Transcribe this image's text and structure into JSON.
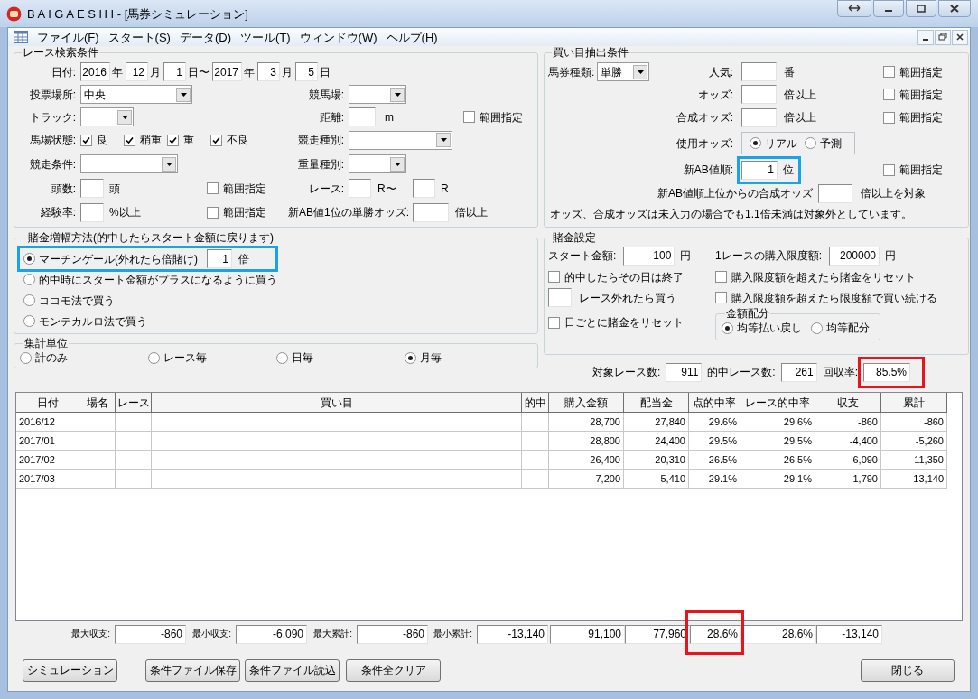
{
  "window": {
    "title": "B A I G A E S H I - [馬券シミュレーション]"
  },
  "menu": [
    "ファイル(F)",
    "スタート(S)",
    "データ(D)",
    "ツール(T)",
    "ウィンドウ(W)",
    "ヘルプ(H)"
  ],
  "race_search": {
    "title": "レース検索条件",
    "date": {
      "label": "日付:",
      "parts": [
        {
          "value": "2016",
          "unit": "年"
        },
        {
          "value": "12",
          "unit": "月"
        },
        {
          "value": "1",
          "unit": "日〜"
        },
        {
          "value": "2017",
          "unit": "年"
        },
        {
          "value": "3",
          "unit": "月"
        },
        {
          "value": "5",
          "unit": "日"
        }
      ]
    },
    "venue_type": {
      "label": "投票場所:",
      "value": "中央"
    },
    "racecourse": {
      "label": "競馬場:"
    },
    "track": {
      "label": "トラック:"
    },
    "distance": {
      "label": "距離:",
      "unit": "m"
    },
    "distance_range": {
      "label": "範囲指定",
      "checked": false
    },
    "going": {
      "label": "馬場状態:",
      "options": [
        {
          "label": "良",
          "checked": true
        },
        {
          "label": "稍重",
          "checked": true
        },
        {
          "label": "重",
          "checked": true
        },
        {
          "label": "不良",
          "checked": true
        }
      ]
    },
    "race_type": {
      "label": "競走種別:"
    },
    "race_condition": {
      "label": "競走条件:"
    },
    "weight_type": {
      "label": "重量種別:"
    },
    "runners": {
      "label": "頭数:",
      "unit": "頭"
    },
    "runners_range": {
      "label": "範囲指定",
      "checked": false
    },
    "race": {
      "label": "レース:",
      "from_unit": "R〜",
      "to_unit": "R"
    },
    "experience": {
      "label": "経験率:",
      "unit": "%以上"
    },
    "experience_range": {
      "label": "範囲指定",
      "checked": false
    },
    "ab_top_odds": {
      "label": "新AB値1位の単勝オッズ:",
      "unit": "倍以上"
    }
  },
  "bet_extraction": {
    "title": "買い目抽出条件",
    "ticket_type": {
      "label": "馬券種類:",
      "value": "単勝"
    },
    "popularity": {
      "label": "人気:",
      "unit": "番",
      "range": {
        "label": "範囲指定",
        "checked": false
      }
    },
    "odds": {
      "label": "オッズ:",
      "unit": "倍以上",
      "range": {
        "label": "範囲指定",
        "checked": false
      }
    },
    "combined_odds": {
      "label": "合成オッズ:",
      "unit": "倍以上",
      "range": {
        "label": "範囲指定",
        "checked": false
      }
    },
    "odds_used": {
      "label": "使用オッズ:",
      "options": [
        {
          "label": "リアル",
          "selected": true
        },
        {
          "label": "予測",
          "selected": false
        }
      ]
    },
    "ab_rank": {
      "label": "新AB値順:",
      "value": "1",
      "unit": "位",
      "highlight": {
        "color": "#1aa3e8"
      },
      "range": {
        "label": "範囲指定",
        "checked": false
      }
    },
    "ab_combined": {
      "label": "新AB値順上位からの合成オッズ",
      "unit": "倍以上を対象"
    },
    "note": "オッズ、合成オッズは未入力の場合でも1.1倍未満は対象外としています。"
  },
  "bet_increase": {
    "title": "賭金増幅方法(的中したらスタート金額に戻ります)",
    "options": [
      {
        "label": "マーチンゲール(外れたら倍賭け)",
        "selected": true,
        "value": "1",
        "unit": "倍",
        "highlight": {
          "color": "#1aa3e8"
        }
      },
      {
        "label": "的中時にスタート金額がプラスになるように買う",
        "selected": false
      },
      {
        "label": "ココモ法で買う",
        "selected": false
      },
      {
        "label": "モンテカルロ法で買う",
        "selected": false
      }
    ]
  },
  "aggregation": {
    "title": "集計単位",
    "options": [
      {
        "label": "計のみ",
        "selected": false
      },
      {
        "label": "レース毎",
        "selected": false
      },
      {
        "label": "日毎",
        "selected": false
      },
      {
        "label": "月毎",
        "selected": true
      }
    ]
  },
  "bet_settings": {
    "title": "賭金設定",
    "start_amount": {
      "label": "スタート金額:",
      "value": "100",
      "unit": "円"
    },
    "limit": {
      "label": "1レースの購入限度額:",
      "value": "200000",
      "unit": "円"
    },
    "stop_on_hit": {
      "label": "的中したらその日は終了",
      "checked": false
    },
    "reset_over_limit": {
      "label": "購入限度額を超えたら賭金をリセット",
      "checked": false
    },
    "skip_races": {
      "label": "レース外れたら買う"
    },
    "continue_at_limit": {
      "label": "購入限度額を超えたら限度額で買い続ける",
      "checked": false
    },
    "daily_reset": {
      "label": "日ごとに賭金をリセット",
      "checked": false
    },
    "allocation": {
      "title": "金額配分",
      "options": [
        {
          "label": "均等払い戻し",
          "selected": true
        },
        {
          "label": "均等配分",
          "selected": false
        }
      ]
    }
  },
  "summary": [
    {
      "label": "対象レース数:",
      "value": "911"
    },
    {
      "label": "的中レース数:",
      "value": "261"
    },
    {
      "label": "回収率:",
      "value": "85.5%",
      "highlight": {
        "color": "#e8141c"
      }
    }
  ],
  "table": {
    "columns": [
      "日付",
      "場名",
      "レース",
      "買い目",
      "的中",
      "購入金額",
      "配当金",
      "点的中率",
      "レース的中率",
      "収支",
      "累計"
    ],
    "rows": [
      [
        "2016/12",
        null,
        null,
        null,
        null,
        "28,700",
        "27,840",
        "29.6%",
        "29.6%",
        "-860",
        "-860"
      ],
      [
        "2017/01",
        null,
        null,
        null,
        null,
        "28,800",
        "24,400",
        "29.5%",
        "29.5%",
        "-4,400",
        "-5,260"
      ],
      [
        "2017/02",
        null,
        null,
        null,
        null,
        "26,400",
        "20,310",
        "26.5%",
        "26.5%",
        "-6,090",
        "-11,350"
      ],
      [
        "2017/03",
        null,
        null,
        null,
        null,
        "7,200",
        "5,410",
        "29.1%",
        "29.1%",
        "-1,790",
        "-13,140"
      ]
    ]
  },
  "totals": {
    "stats": [
      {
        "label": "最大収支:",
        "value": "-860"
      },
      {
        "label": "最小収支:",
        "value": "-6,090"
      },
      {
        "label": "最大累計:",
        "value": "-860"
      },
      {
        "label": "最小累計:",
        "value": "-13,140"
      }
    ],
    "cells": [
      {
        "value": "91,100"
      },
      {
        "value": "77,960"
      },
      {
        "value": "28.6%",
        "highlight": {
          "color": "#e8141c"
        }
      },
      {
        "value": "28.6%"
      },
      {
        "value": "-13,140"
      }
    ]
  },
  "buttons": [
    {
      "label": "シミュレーション",
      "kind": "action"
    },
    {
      "label": "条件ファイル保存",
      "kind": "action"
    },
    {
      "label": "条件ファイル読込",
      "kind": "action"
    },
    {
      "label": "条件全クリア",
      "kind": "action"
    },
    {
      "label": "閉じる",
      "kind": "close"
    }
  ]
}
